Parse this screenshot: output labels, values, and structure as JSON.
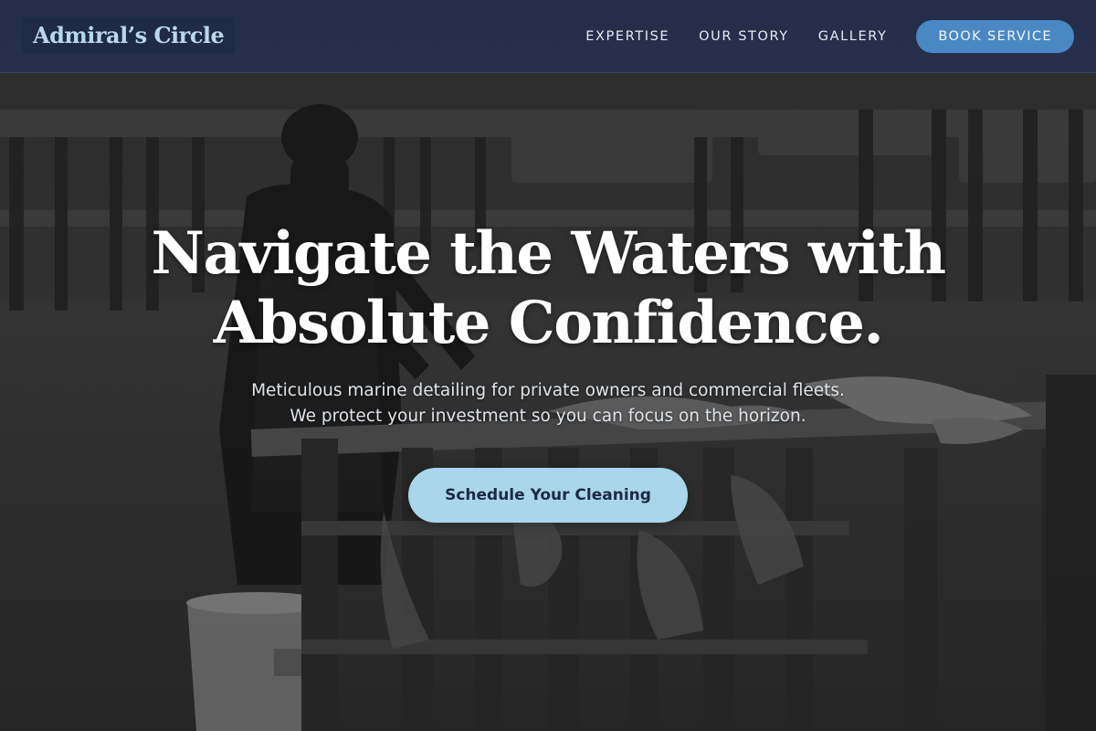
{
  "brand": {
    "logo_text": "Admiral’s Circle"
  },
  "nav": {
    "links": [
      {
        "label": "EXPERTISE"
      },
      {
        "label": "OUR STORY"
      },
      {
        "label": "GALLERY"
      }
    ],
    "cta_label": "BOOK SERVICE"
  },
  "hero": {
    "title_line1": "Navigate the Waters with",
    "title_line2": "Absolute Confidence.",
    "subtitle_line1": "Meticulous marine detailing for private owners and commercial fleets.",
    "subtitle_line2": "We protect your investment so you can focus on the horizon.",
    "cta_label": "Schedule Your Cleaning",
    "background_icon": "photo-fisherman-cleaning-fish-on-dock"
  },
  "colors": {
    "header_bg": "#232c48",
    "logo_text": "#b8d8ec",
    "nav_cta_bg": "#4a88c4",
    "hero_cta_bg": "#a9d6ea",
    "hero_cta_text": "#1d2a44"
  }
}
